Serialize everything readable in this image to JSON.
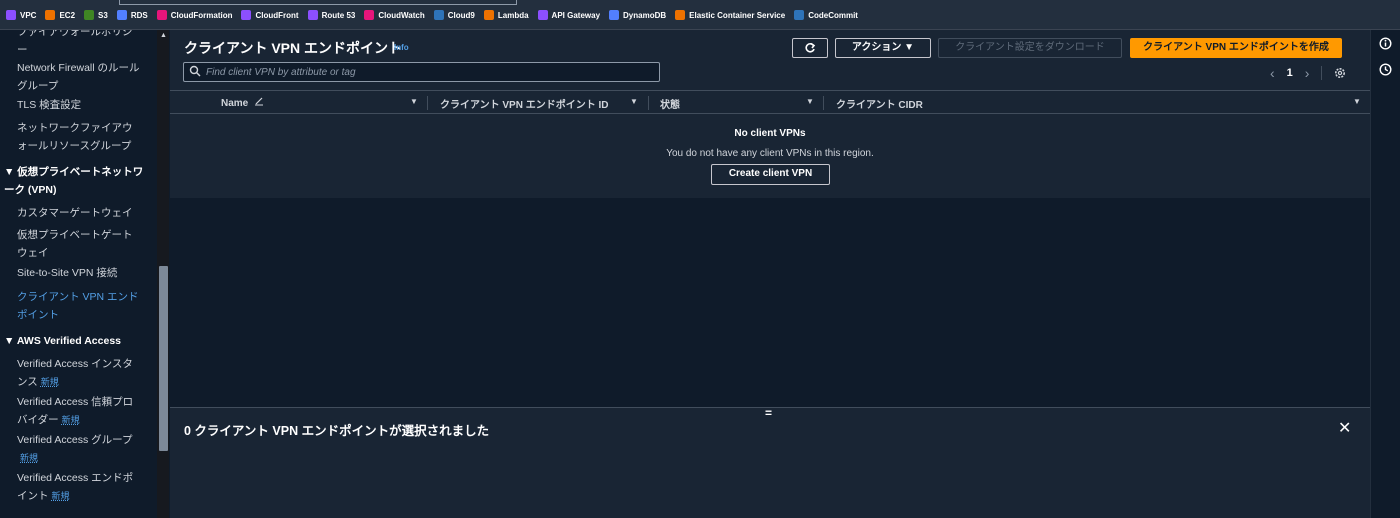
{
  "favorites": [
    {
      "label": "VPC",
      "color": "#8c4fff"
    },
    {
      "label": "EC2",
      "color": "#ed7100"
    },
    {
      "label": "S3",
      "color": "#3f8624"
    },
    {
      "label": "RDS",
      "color": "#527fff"
    },
    {
      "label": "CloudFormation",
      "color": "#e7157b"
    },
    {
      "label": "CloudFront",
      "color": "#8c4fff"
    },
    {
      "label": "Route 53",
      "color": "#8c4fff"
    },
    {
      "label": "CloudWatch",
      "color": "#e7157b"
    },
    {
      "label": "Cloud9",
      "color": "#2e73b8"
    },
    {
      "label": "Lambda",
      "color": "#ed7100"
    },
    {
      "label": "API Gateway",
      "color": "#8c4fff"
    },
    {
      "label": "DynamoDB",
      "color": "#527fff"
    },
    {
      "label": "Elastic Container Service",
      "color": "#ed7100"
    },
    {
      "label": "CodeCommit",
      "color": "#2e73b8"
    }
  ],
  "sidebar": {
    "cut_item": "ファイアウォールポリシー",
    "items": [
      {
        "label": "Network Firewall のルールグループ"
      },
      {
        "label": "TLS 検査設定"
      },
      {
        "label": "ネットワークファイアウォールリソースグループ"
      },
      {
        "label": "▼ 仮想プライベートネットワーク (VPN)",
        "section": true
      },
      {
        "label": "カスタマーゲートウェイ"
      },
      {
        "label": "仮想プライベートゲートウェイ"
      },
      {
        "label": "Site-to-Site VPN 接続"
      },
      {
        "label": "クライアント VPN エンドポイント",
        "active": true
      },
      {
        "label": "▼ AWS Verified Access",
        "section": true
      },
      {
        "label": "Verified Access インスタンス",
        "badge": "新規"
      },
      {
        "label": "Verified Access 信頼プロバイダー",
        "badge": "新規"
      },
      {
        "label": "Verified Access グループ",
        "badge": "新規"
      },
      {
        "label": "Verified Access エンドポイント",
        "badge": "新規"
      }
    ]
  },
  "header": {
    "title": "クライアント VPN エンドポイント",
    "info": "Info",
    "actions_label": "アクション ▼",
    "download_label": "クライアント設定をダウンロード",
    "create_label": "クライアント VPN エンドポイントを作成"
  },
  "search": {
    "placeholder": "Find client VPN by attribute or tag",
    "value": ""
  },
  "pagination": {
    "page": "1"
  },
  "table": {
    "columns": [
      "Name",
      "クライアント VPN エンドポイント ID",
      "状態",
      "クライアント CIDR"
    ]
  },
  "empty": {
    "title": "No client VPNs",
    "message": "You do not have any client VPNs in this region.",
    "button": "Create client VPN"
  },
  "split_panel": {
    "handle": "=",
    "title": "0 クライアント VPN エンドポイントが選択されました",
    "close": "✕"
  },
  "icons": {
    "refresh": "refresh-icon",
    "search": "search-icon",
    "settings": "gear-icon",
    "info": "info-icon",
    "clock": "clock-icon"
  }
}
